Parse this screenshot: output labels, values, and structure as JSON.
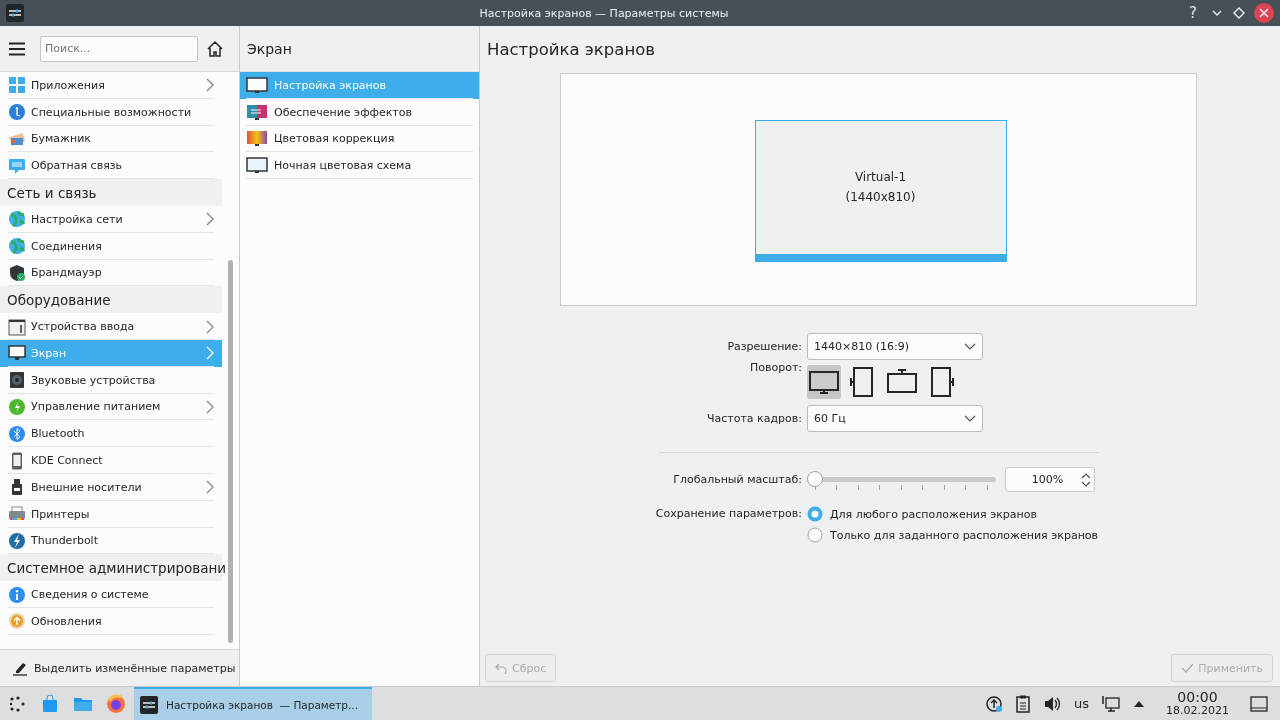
{
  "window": {
    "title": "Настройка экранов — Параметры системы",
    "help_button": "?"
  },
  "sidebar": {
    "search": {
      "placeholder": "Поиск..."
    },
    "groups": [
      {
        "items": [
          {
            "label": "Приложения",
            "has_children": true,
            "selected": false
          },
          {
            "label": "Специальные возможности",
            "has_children": false,
            "selected": false
          },
          {
            "label": "Бумажник",
            "has_children": false,
            "selected": false
          },
          {
            "label": "Обратная связь",
            "has_children": false,
            "selected": false
          }
        ]
      },
      {
        "title": "Сеть и связь",
        "items": [
          {
            "label": "Настройка сети",
            "has_children": true,
            "selected": false
          },
          {
            "label": "Соединения",
            "has_children": false,
            "selected": false
          },
          {
            "label": "Брандмауэр",
            "has_children": false,
            "selected": false
          }
        ]
      },
      {
        "title": "Оборудование",
        "items": [
          {
            "label": "Устройства ввода",
            "has_children": true,
            "selected": false
          },
          {
            "label": "Экран",
            "has_children": true,
            "selected": true
          },
          {
            "label": "Звуковые устройства",
            "has_children": false,
            "selected": false
          },
          {
            "label": "Управление питанием",
            "has_children": true,
            "selected": false
          },
          {
            "label": "Bluetooth",
            "has_children": false,
            "selected": false
          },
          {
            "label": "KDE Connect",
            "has_children": false,
            "selected": false
          },
          {
            "label": "Внешние носители",
            "has_children": true,
            "selected": false
          },
          {
            "label": "Принтеры",
            "has_children": false,
            "selected": false
          },
          {
            "label": "Thunderbolt",
            "has_children": false,
            "selected": false
          }
        ]
      },
      {
        "title": "Системное администрировани",
        "items": [
          {
            "label": "Сведения о системе",
            "has_children": false,
            "selected": false
          },
          {
            "label": "Обновления",
            "has_children": false,
            "selected": false
          }
        ]
      }
    ],
    "highlight_button": "Выделить изменённые параметры"
  },
  "subpages": {
    "title": "Экран",
    "items": [
      {
        "label": "Настройка экранов",
        "selected": true
      },
      {
        "label": "Обеспечение эффектов",
        "selected": false
      },
      {
        "label": "Цветовая коррекция",
        "selected": false
      },
      {
        "label": "Ночная цветовая схема",
        "selected": false
      }
    ]
  },
  "main": {
    "title": "Настройка экранов",
    "output": {
      "name": "Virtual-1",
      "resolution": "(1440x810)"
    },
    "resolution": {
      "label": "Разрешение:",
      "value": "1440×810 (16:9)"
    },
    "rotation": {
      "label": "Поворот:",
      "options": [
        {
          "selected": true
        },
        {
          "selected": false
        },
        {
          "selected": false
        },
        {
          "selected": false
        }
      ]
    },
    "refresh_rate": {
      "label": "Частота кадров:",
      "value": "60 Гц"
    },
    "scale": {
      "label": "Глобальный масштаб:",
      "level": 0,
      "value": "100%"
    },
    "save": {
      "label": "Сохранение параметров:",
      "options": [
        {
          "label": "Для любого расположения экранов",
          "selected": true
        },
        {
          "label": "Только для заданного расположения экранов",
          "selected": false
        }
      ]
    },
    "reset_button": {
      "label": "Сброс",
      "disabled": true
    },
    "apply_button": {
      "label": "Применить",
      "disabled": true
    }
  },
  "taskbar": {
    "task": {
      "label": "Настройка экранов  — Параметр...",
      "selected": true
    },
    "keyboard_layout": "us",
    "time": "00:00",
    "date": "18.02.2021"
  }
}
